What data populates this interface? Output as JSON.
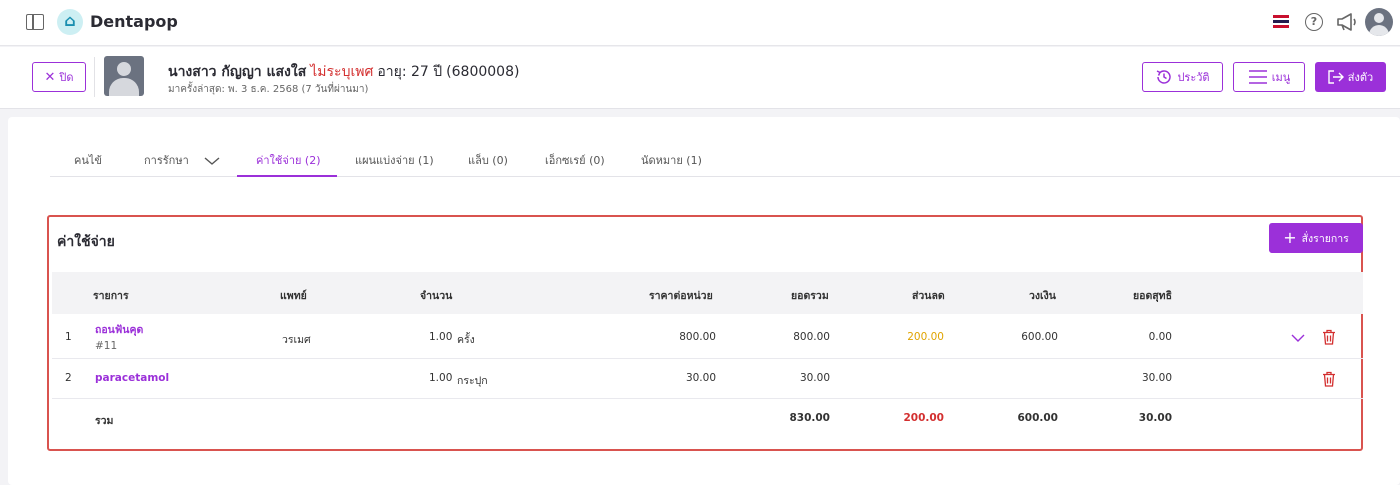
{
  "app": {
    "brand": "Dentapop"
  },
  "header": {
    "help_glyph": "?"
  },
  "patient": {
    "close_label": "ปิด",
    "name": "นางสาว กัญญา แสงใส",
    "gender": "ไม่ระบุเพศ",
    "age": "อายุ: 27 ปี",
    "hn": "(6800008)",
    "last_visit": "มาครั้งล่าสุด: พ. 3 ธ.ค. 2568 (7 วันที่ผ่านมา)",
    "history_label": "ประวัติ",
    "menu_label": "เมนู",
    "send_label": "ส่งตัว"
  },
  "tabs": [
    {
      "label": "คนไข้"
    },
    {
      "label": "การรักษา"
    },
    {
      "label": "ค่าใช้จ่าย (2)"
    },
    {
      "label": "แผนแบ่งจ่าย (1)"
    },
    {
      "label": "แล็บ (0)"
    },
    {
      "label": "เอ็กซเรย์ (0)"
    },
    {
      "label": "นัดหมาย (1)"
    }
  ],
  "expenses": {
    "title": "ค่าใช้จ่าย",
    "order_label": "สั่งรายการ",
    "columns": [
      "รายการ",
      "แพทย์",
      "จำนวน",
      "ราคาต่อหน่วย",
      "ยอดรวม",
      "ส่วนลด",
      "วงเงิน",
      "ยอดสุทธิ"
    ],
    "rows": [
      {
        "no": "1",
        "item": "ถอนฟันคุด",
        "tooth": "#11",
        "doctor": "วรเมศ",
        "qty": "1.00",
        "unit": "ครั้ง",
        "unit_price": "800.00",
        "total": "800.00",
        "discount": "200.00",
        "credit": "600.00",
        "net": "0.00"
      },
      {
        "no": "2",
        "item": "paracetamol",
        "tooth": "",
        "doctor": "",
        "qty": "1.00",
        "unit": "กระปุก",
        "unit_price": "30.00",
        "total": "30.00",
        "discount": "",
        "credit": "",
        "net": "30.00"
      }
    ],
    "totals": {
      "label": "รวม",
      "total": "830.00",
      "discount": "200.00",
      "credit": "600.00",
      "net": "30.00"
    }
  },
  "colors": {
    "accent": "#9b30d9",
    "danger": "#d32f2f",
    "discount": "#e0a400"
  }
}
